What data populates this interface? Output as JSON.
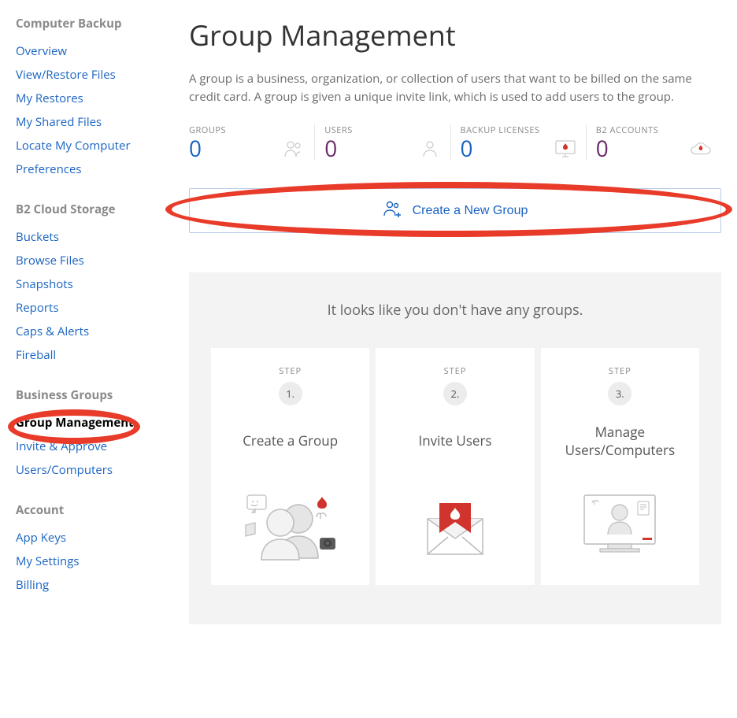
{
  "sidebar": {
    "sections": [
      {
        "heading": "Computer Backup",
        "items": [
          "Overview",
          "View/Restore Files",
          "My Restores",
          "My Shared Files",
          "Locate My Computer",
          "Preferences"
        ]
      },
      {
        "heading": "B2 Cloud Storage",
        "items": [
          "Buckets",
          "Browse Files",
          "Snapshots",
          "Reports",
          "Caps & Alerts",
          "Fireball"
        ]
      },
      {
        "heading": "Business Groups",
        "items": [
          "Group Management",
          "Invite & Approve",
          "Users/Computers"
        ],
        "active": "Group Management"
      },
      {
        "heading": "Account",
        "items": [
          "App Keys",
          "My Settings",
          "Billing"
        ]
      }
    ]
  },
  "page": {
    "title": "Group Management",
    "description": "A group is a business, organization, or collection of users that want to be billed on the same credit card. A group is given a unique invite link, which is used to add users to the group."
  },
  "stats": {
    "groups": {
      "label": "GROUPS",
      "value": "0"
    },
    "users": {
      "label": "USERS",
      "value": "0"
    },
    "licenses": {
      "label": "BACKUP LICENSES",
      "value": "0"
    },
    "b2": {
      "label": "B2 ACCOUNTS",
      "value": "0"
    }
  },
  "create_button": "Create a New Group",
  "empty": {
    "title": "It looks like you don't have any groups.",
    "step_label": "STEP",
    "steps": [
      {
        "num": "1.",
        "title": "Create a Group"
      },
      {
        "num": "2.",
        "title": "Invite Users"
      },
      {
        "num": "3.",
        "title": "Manage Users/Computers"
      }
    ]
  }
}
